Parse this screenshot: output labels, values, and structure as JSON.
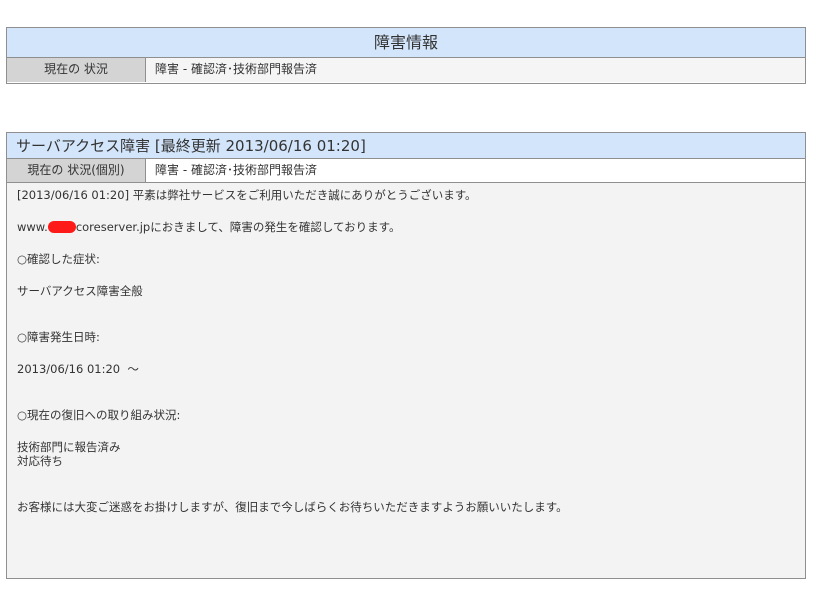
{
  "box1": {
    "title": "障害情報",
    "status_label": "現在の 状況",
    "status_value": "障害 - 確認済･技術部門報告済"
  },
  "box2": {
    "title": "サーバアクセス障害 [最終更新 2013/06/16 01:20]",
    "status_label": "現在の 状況(個別)",
    "status_value": "障害 - 確認済･技術部門報告済",
    "lines": {
      "greeting": "[2013/06/16 01:20] 平素は弊社サービスをご利用いただき誠にありがとうございます。",
      "host_prefix": "www.",
      "host_suffix": "coreserver.jpにおきまして、障害の発生を確認しております。",
      "symptom_heading": "○確認した症状:",
      "symptom_value": "サーバアクセス障害全般",
      "date_heading": "○障害発生日時:",
      "date_value": "2013/06/16 01:20  〜",
      "progress_heading": "○現在の復旧への取り組み状況:",
      "progress_value_1": "技術部門に報告済み",
      "progress_value_2": "対応待ち",
      "apology": "お客様には大変ご迷惑をお掛けしますが、復旧まで今しばらくお待ちいただきますようお願いいたします。"
    }
  }
}
